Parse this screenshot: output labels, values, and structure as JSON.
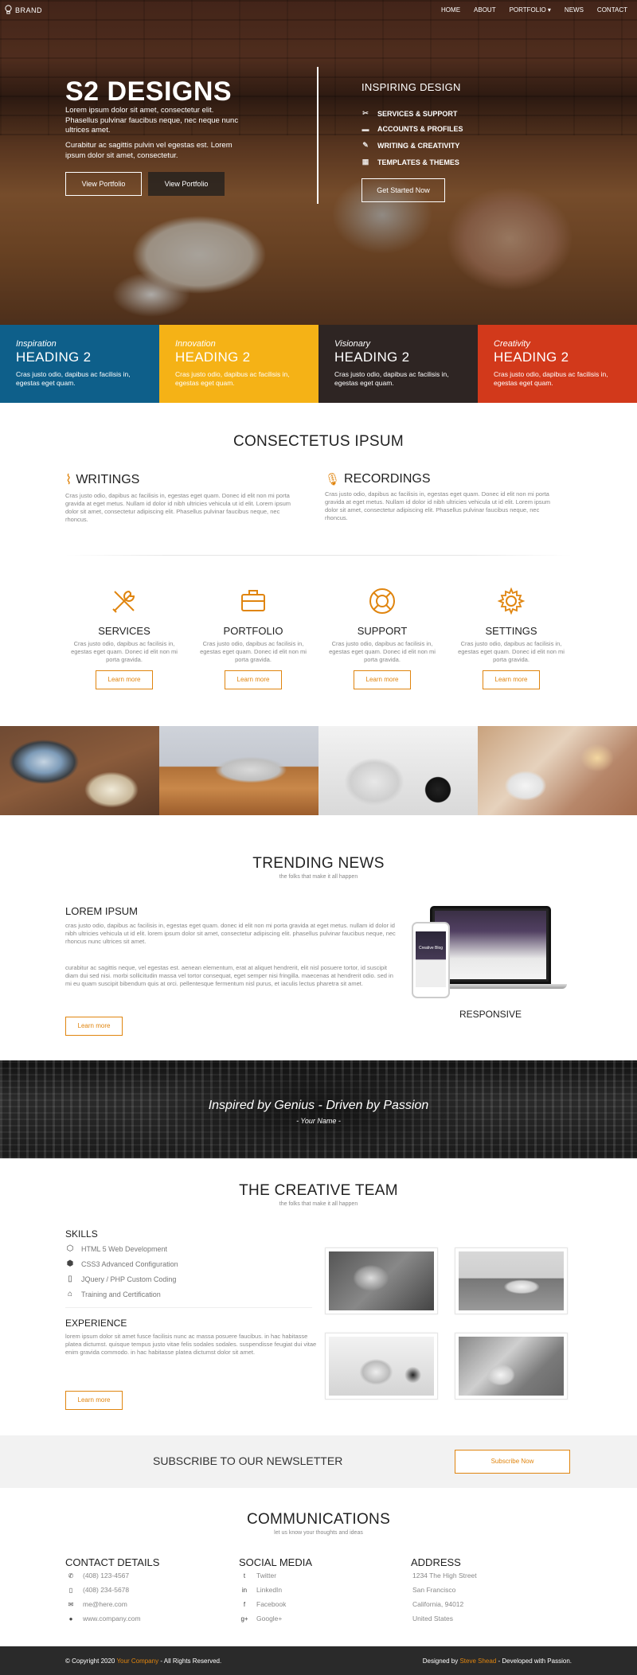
{
  "nav": {
    "brand": "BRAND",
    "links": [
      "HOME",
      "ABOUT",
      "PORTFOLIO ▾",
      "NEWS",
      "CONTACT"
    ]
  },
  "hero": {
    "title": "S2 DESIGNS",
    "text1": "Lorem ipsum dolor sit amet, consectetur elit. Phasellus pulvinar faucibus neque, nec neque nunc ultrices amet.",
    "text2": "Curabitur ac sagittis pulvin vel egestas est. Lorem ipsum dolor sit amet, consectetur.",
    "btn_portfolio_1": "View Portfolio",
    "btn_portfolio_2": "View Portfolio",
    "right_title": "INSPIRING DESIGN",
    "features": [
      "SERVICES & SUPPORT",
      "ACCOUNTS & PROFILES",
      "WRITING & CREATIVITY",
      "TEMPLATES & THEMES"
    ],
    "cta": "Get Started Now"
  },
  "boxes": [
    {
      "italic": "Inspiration",
      "heading": "HEADING 2",
      "text": "Cras justo odio, dapibus ac facilisis in, egestas eget quam.",
      "color": "#0e5f8a"
    },
    {
      "italic": "Innovation",
      "heading": "HEADING 2",
      "text": "Cras justo odio, dapibus ac facilisis in, egestas eget quam.",
      "color": "#f5b216"
    },
    {
      "italic": "Visionary",
      "heading": "HEADING 2",
      "text": "Cras justo odio, dapibus ac facilisis in, egestas eget quam.",
      "color": "#2e2523"
    },
    {
      "italic": "Creativity",
      "heading": "HEADING 2",
      "text": "Cras justo odio, dapibus ac facilisis in, egestas eget quam.",
      "color": "#d2391b"
    }
  ],
  "intro": {
    "title": "CONSECTETUS IPSUM",
    "writings_title": "WRITINGS",
    "writings_text": "Cras justo odio, dapibus ac facilisis in, egestas eget quam. Donec id elit non mi porta gravida at eget metus. Nullam id dolor id nibh ultricies vehicula ut id elit. Lorem ipsum dolor sit amet, consectetur adipiscing elit. Phasellus pulvinar faucibus neque, nec rhoncus.",
    "recordings_title": "RECORDINGS",
    "recordings_text": "Cras justo odio, dapibus ac facilisis in, egestas eget quam. Donec id elit non mi porta gravida at eget metus. Nullam id dolor id nibh ultricies vehicula ut id elit. Lorem ipsum dolor sit amet, consectetur adipiscing elit. Phasellus pulvinar faucibus neque, nec rhoncus."
  },
  "services": [
    {
      "title": "SERVICES",
      "text": "Cras justo odio, dapibus ac facilisis in, egestas eget quam. Donec id elit non mi porta gravida.",
      "button": "Learn more"
    },
    {
      "title": "PORTFOLIO",
      "text": "Cras justo odio, dapibus ac facilisis in, egestas eget quam. Donec id elit non mi porta gravida.",
      "button": "Learn more"
    },
    {
      "title": "SUPPORT",
      "text": "Cras justo odio, dapibus ac facilisis in, egestas eget quam. Donec id elit non mi porta gravida.",
      "button": "Learn more"
    },
    {
      "title": "SETTINGS",
      "text": "Cras justo odio, dapibus ac facilisis in, egestas eget quam. Donec id elit non mi porta gravida.",
      "button": "Learn more"
    }
  ],
  "trending": {
    "title": "TRENDING NEWS",
    "subtitle": "the folks that make it all happen",
    "heading": "LOREM IPSUM",
    "para1": "cras justo odio, dapibus ac facilisis in, egestas eget quam. donec id elit non mi porta gravida at eget metus. nullam id dolor id nibh ultricies vehicula ut id elit. lorem ipsum dolor sit amet, consectetur adipiscing elit. phasellus pulvinar faucibus neque, nec rhoncus nunc ultrices sit amet.",
    "para2": "curabitur ac sagittis neque, vel egestas est. aenean elementum, erat at aliquet hendrerit, elit nisl posuere tortor, id suscipit diam dui sed nisi. morbi sollicitudin massa vel tortor consequat, eget semper nisi fringilla. maecenas at hendrerit odio. sed in mi eu quam suscipit bibendum quis at orci. pellentesque fermentum nisl purus, et iaculis lectus pharetra sit amet.",
    "button": "Learn more",
    "responsive_label": "RESPONSIVE",
    "phone_screen_text": "Creative Blog"
  },
  "banner": {
    "quote": "Inspired by Genius - Driven by Passion",
    "author": "- Your Name -"
  },
  "team": {
    "title": "THE CREATIVE TEAM",
    "subtitle": "the folks that make it all happen",
    "skills_title": "SKILLS",
    "skills": [
      "HTML 5 Web Development",
      "CSS3 Advanced Configuration",
      "JQuery / PHP Custom Coding",
      "Training and Certification"
    ],
    "experience_title": "EXPERIENCE",
    "experience_text": "lorem ipsum dolor sit amet fusce facilisis nunc ac massa posuere faucibus. in hac habitasse platea dictumst. quisque tempus justo vitae felis sodales sodales. suspendisse feugiat dui vitae enim gravida commodo. in hac habitasse platea dictumst dolor sit amet.",
    "button": "Learn more"
  },
  "newsletter": {
    "title": "SUBSCRIBE TO OUR NEWSLETTER",
    "button": "Subscribe Now"
  },
  "communications": {
    "title": "COMMUNICATIONS",
    "subtitle": "let us know your thoughts and ideas",
    "contact_title": "CONTACT DETAILS",
    "contact": [
      "(408) 123-4567",
      "(408) 234-5678",
      "me@here.com",
      "www.company.com"
    ],
    "social_title": "SOCIAL MEDIA",
    "social": [
      "Twitter",
      "LinkedIn",
      "Facebook",
      "Google+"
    ],
    "address_title": "ADDRESS",
    "address": [
      "1234 The High Street",
      "San Francisco",
      "California, 94012",
      "United States"
    ]
  },
  "footer": {
    "copy_pre": "© Copyright 2020",
    "company": "Your Company",
    "copy_post": "- All Rights Reserved.",
    "designed_pre": "Designed by",
    "designer": "Steve Shead",
    "designed_post": "- Developed with Passion."
  },
  "colors": {
    "accent": "#e0850f",
    "blue": "#0e5f8a",
    "yellow": "#f5b216",
    "dark": "#2e2523",
    "red": "#d2391b"
  }
}
